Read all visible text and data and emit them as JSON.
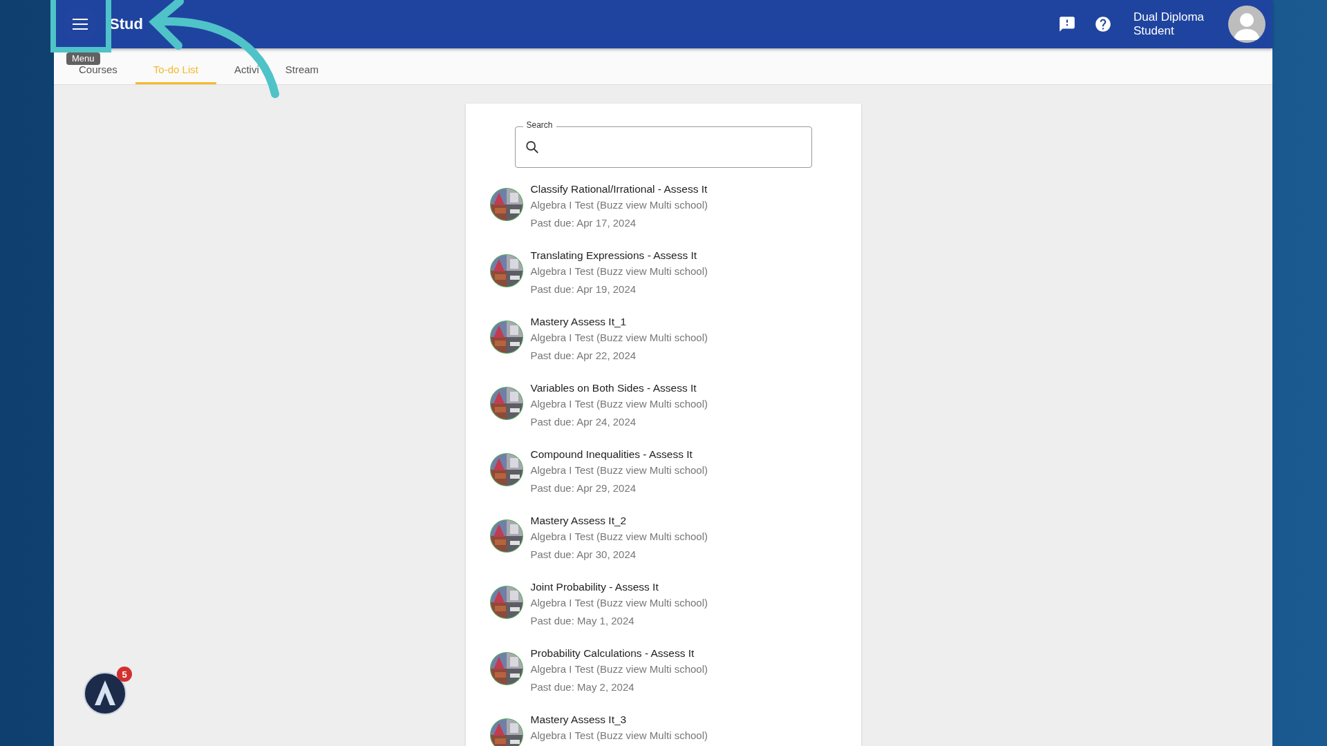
{
  "header": {
    "title": "Stud",
    "user_name": "Dual Diploma Student"
  },
  "tooltip": "Menu",
  "tabs": [
    {
      "label": "Courses",
      "selected": false
    },
    {
      "label": "To-do List",
      "selected": true
    },
    {
      "label": "Activi",
      "selected": false,
      "label_tail": "Stream"
    }
  ],
  "search": {
    "label": "Search"
  },
  "todo_items": [
    {
      "title": "Classify Rational/Irrational - Assess It",
      "course": "Algebra I Test (Buzz view Multi school)",
      "due": "Past due: Apr 17, 2024"
    },
    {
      "title": "Translating Expressions - Assess It",
      "course": "Algebra I Test (Buzz view Multi school)",
      "due": "Past due: Apr 19, 2024"
    },
    {
      "title": "Mastery Assess It_1",
      "course": "Algebra I Test (Buzz view Multi school)",
      "due": "Past due: Apr 22, 2024"
    },
    {
      "title": "Variables on Both Sides - Assess It",
      "course": "Algebra I Test (Buzz view Multi school)",
      "due": "Past due: Apr 24, 2024"
    },
    {
      "title": "Compound Inequalities - Assess It",
      "course": "Algebra I Test (Buzz view Multi school)",
      "due": "Past due: Apr 29, 2024"
    },
    {
      "title": "Mastery Assess It_2",
      "course": "Algebra I Test (Buzz view Multi school)",
      "due": "Past due: Apr 30, 2024"
    },
    {
      "title": "Joint Probability - Assess It",
      "course": "Algebra I Test (Buzz view Multi school)",
      "due": "Past due: May 1, 2024"
    },
    {
      "title": "Probability Calculations - Assess It",
      "course": "Algebra I Test (Buzz view Multi school)",
      "due": "Past due: May 2, 2024"
    },
    {
      "title": "Mastery Assess It_3",
      "course": "Algebra I Test (Buzz view Multi school)"
    }
  ],
  "help_widget": {
    "count": "5"
  }
}
